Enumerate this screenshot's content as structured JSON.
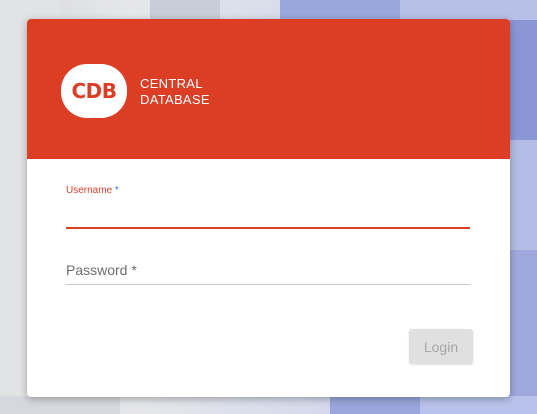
{
  "brand": {
    "logo_text": "CDB",
    "name_line1": "CENTRAL",
    "name_line2": "DATABASE",
    "color": "#dc3e25"
  },
  "form": {
    "username": {
      "label": "Username",
      "required_mark": "*",
      "value": "",
      "state": "focused"
    },
    "password": {
      "label": "Password",
      "required_mark": "*",
      "value": ""
    },
    "login_button": {
      "label": "Login",
      "state": "disabled"
    }
  }
}
